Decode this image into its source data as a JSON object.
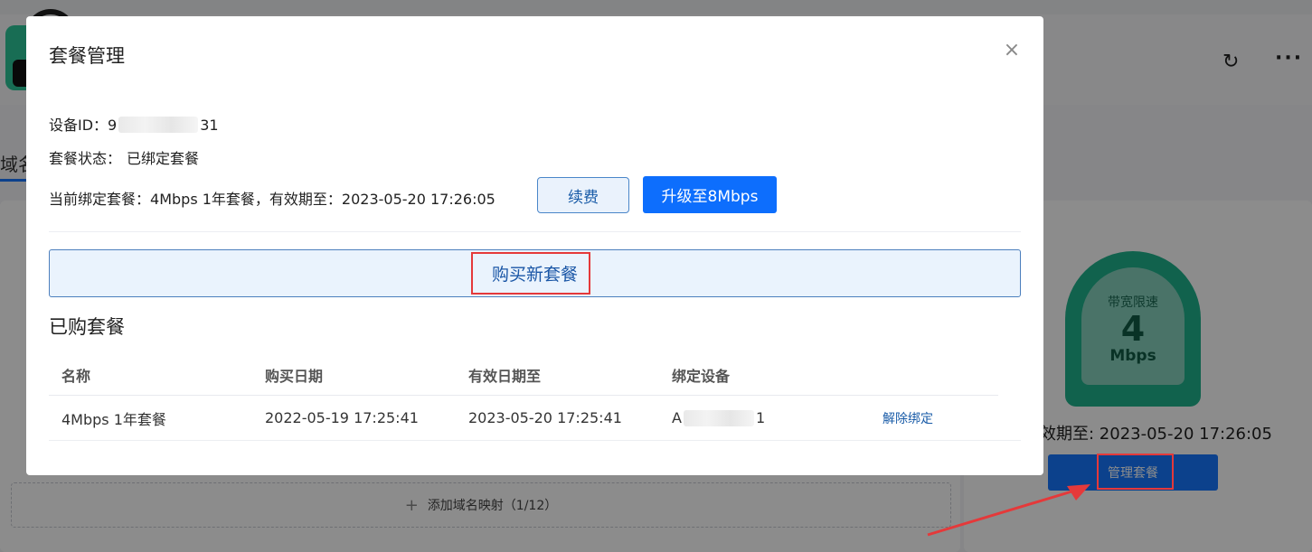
{
  "background": {
    "tab_partial": "域名",
    "add_mapping_label": "添加域名映射（1/12）",
    "gauge": {
      "label": "带宽限速",
      "value": "4",
      "unit": "Mbps"
    },
    "expiry_text": "效期至: 2023-05-20 17:26:05",
    "manage_button": "管理套餐",
    "accent_color": "#1677ff"
  },
  "modal": {
    "title": "套餐管理",
    "device_id_label": "设备ID：",
    "device_id_prefix": "9",
    "device_id_suffix": "31",
    "status_label": "套餐状态：",
    "status_value": "已绑定套餐",
    "current_label": "当前绑定套餐：",
    "current_value": "4Mbps 1年套餐，有效期至：2023-05-20 17:26:05",
    "renew_button": "续费",
    "upgrade_button": "升级至8Mbps",
    "buy_new_button": "购买新套餐",
    "purchased_title": "已购套餐",
    "table": {
      "headers": [
        "名称",
        "购买日期",
        "有效日期至",
        "绑定设备",
        ""
      ],
      "rows": [
        {
          "name": "4Mbps 1年套餐",
          "purchase_date": "2022-05-19 17:25:41",
          "expire_date": "2023-05-20 17:25:41",
          "device_prefix": "A",
          "device_suffix": "1",
          "action": "解除绑定"
        }
      ]
    }
  },
  "colors": {
    "primary": "#0d6efd",
    "highlight": "#e5393a",
    "gauge": "#1fb28c"
  },
  "icons": [
    "refresh-icon",
    "more-icon",
    "close-icon",
    "plus-icon"
  ]
}
